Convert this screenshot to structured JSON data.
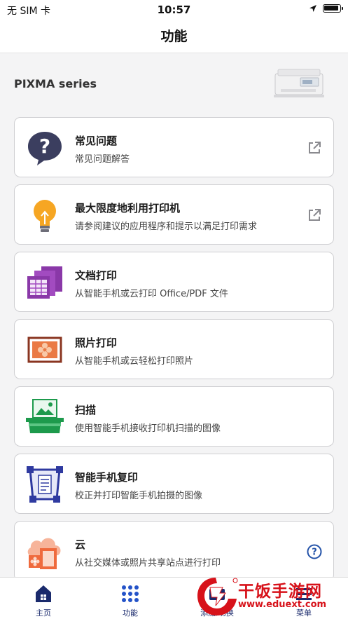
{
  "status_bar": {
    "carrier": "无 SIM 卡",
    "time": "10:57"
  },
  "nav": {
    "title": "功能"
  },
  "printer": {
    "series": "PIXMA series",
    "image": "printer-image"
  },
  "menu": [
    {
      "title": "常见问题",
      "subtitle": "常见问题解答",
      "icon": "faq-question-icon",
      "trailing": "external-link-icon"
    },
    {
      "title": "最大限度地利用打印机",
      "subtitle": "请参阅建议的应用程序和提示以满足打印需求",
      "icon": "lightbulb-icon",
      "trailing": "external-link-icon"
    },
    {
      "title": "文档打印",
      "subtitle": "从智能手机或云打印 Office/PDF 文件",
      "icon": "document-print-icon",
      "trailing": ""
    },
    {
      "title": "照片打印",
      "subtitle": "从智能手机或云轻松打印照片",
      "icon": "photo-print-icon",
      "trailing": ""
    },
    {
      "title": "扫描",
      "subtitle": "使用智能手机接收打印机扫描的图像",
      "icon": "scanner-icon",
      "trailing": ""
    },
    {
      "title": "智能手机复印",
      "subtitle": "校正并打印智能手机拍摄的图像",
      "icon": "smartphone-copy-icon",
      "trailing": ""
    },
    {
      "title": "云",
      "subtitle": "从社交媒体或照片共享站点进行打印",
      "icon": "cloud-print-icon",
      "trailing": "help-circle-icon"
    }
  ],
  "tabs": [
    {
      "label": "主页",
      "icon": "home-icon"
    },
    {
      "label": "功能",
      "icon": "grid-icon"
    },
    {
      "label": "添加/切换",
      "icon": "add-switch-icon"
    },
    {
      "label": "菜单",
      "icon": "menu-icon"
    }
  ],
  "watermark": {
    "text": "干饭手游网",
    "url": "www.eduext.com"
  },
  "colors": {
    "brand_navy": "#1a2a6c",
    "link_blue": "#2453a8",
    "watermark_red": "#d7121a"
  }
}
